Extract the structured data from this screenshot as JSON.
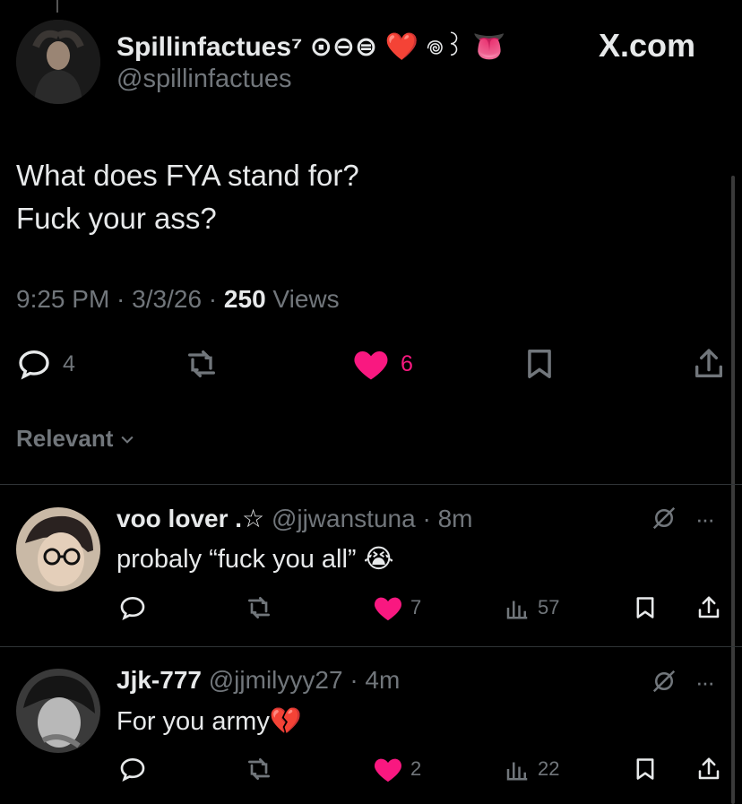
{
  "brand": "X.com",
  "tweet": {
    "author_name": "Spillinfactues⁷ ⊙⊖⊜",
    "author_emoji": "❤️ 𖦹꒱ 👅",
    "handle": "@spillinfactues",
    "text": "What does FYA stand for?\nFuck your ass?",
    "time": "9:25 PM",
    "date": "3/3/26",
    "views_count": "250",
    "views_label": "Views",
    "replies": "4",
    "likes": "6"
  },
  "sort": {
    "label": "Relevant"
  },
  "replies": [
    {
      "name": "voo lover .☆",
      "handle": "@jjwanstuna",
      "age": "8m",
      "text": "probaly “fuck you all” 😭",
      "likes": "7",
      "views": "57"
    },
    {
      "name": "Jjk-777",
      "handle": "@jjmilyyy27",
      "age": "4m",
      "text": "For you army💔",
      "likes": "2",
      "views": "22"
    }
  ],
  "colors": {
    "like": "#f91880",
    "muted": "#71767b",
    "text": "#e7e9ea",
    "divider": "#2f3336"
  }
}
